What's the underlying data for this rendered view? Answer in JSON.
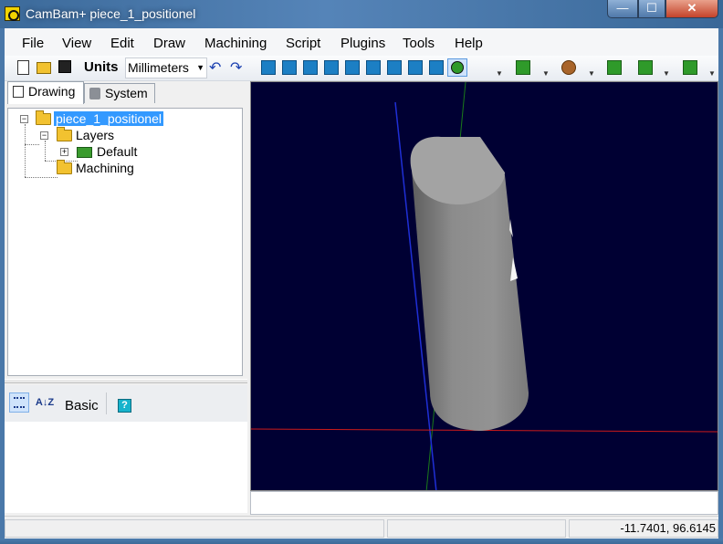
{
  "window": {
    "title": "CamBam+  piece_1_positionel",
    "minimize_glyph": "—",
    "maximize_glyph": "☐",
    "close_glyph": "✕"
  },
  "menu": [
    "File",
    "View",
    "Edit",
    "Draw",
    "Machining",
    "Script",
    "Plugins",
    "Tools",
    "Help"
  ],
  "toolbar": {
    "units_label": "Units",
    "units_value": "Millimeters",
    "undo_glyph": "↶",
    "redo_glyph": "↷"
  },
  "tabs": {
    "drawing": "Drawing",
    "system": "System"
  },
  "tree": {
    "root": "piece_1_positionel",
    "layers": "Layers",
    "default_layer": "Default",
    "machining": "Machining",
    "expand_glyph": "+",
    "collapse_glyph": "−"
  },
  "properties": {
    "basic_label": "Basic",
    "help_glyph": "?",
    "sort_glyph": "A↓Z"
  },
  "status": {
    "coordinates": "-11.7401, 96.6145"
  },
  "colors": {
    "viewport_bg": "#000033",
    "x_axis": "#cc1a1a",
    "y_axis": "#1a7a1a",
    "z_axis": "#1f2fd6",
    "part_fill": "#8f8f8f",
    "selection": "#3399ff"
  },
  "icons": [
    "new-file-icon",
    "open-folder-icon",
    "save-icon",
    "undo-icon",
    "redo-icon",
    "view-icon",
    "grid-icon",
    "zoom-icon",
    "snap-icon",
    "select-icon",
    "layer-icon",
    "profile-icon",
    "pocket-icon",
    "drill-icon",
    "tool-icon",
    "script-icon",
    "help-icon"
  ]
}
